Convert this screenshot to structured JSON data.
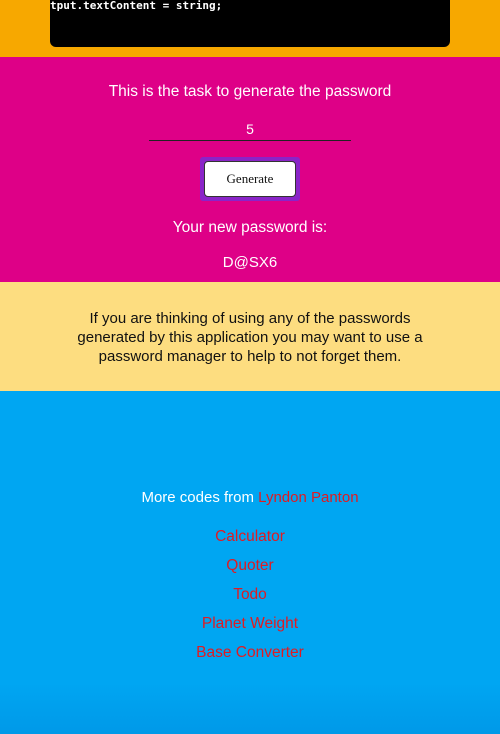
{
  "code": {
    "line": "tput.textContent = string;"
  },
  "task": {
    "title": "This is the task to generate the password",
    "length_value": "5",
    "generate_label": "Generate",
    "new_label": "Your new password is:",
    "password": "D@SX6"
  },
  "notice": {
    "text": "If you are thinking of using any of the passwords generated by this application you may want to use a password manager to help to not forget them."
  },
  "footer": {
    "more_prefix": "More codes from",
    "author": "Lyndon Panton",
    "links": [
      "Calculator",
      "Quoter",
      "Todo",
      "Planet Weight",
      "Base Converter"
    ]
  },
  "colors": {
    "orange": "#f7a800",
    "magenta": "#de0087",
    "yellow": "#fddd80",
    "blue": "#00a6f2",
    "link_red": "#e01b22",
    "purple": "#8a24c8"
  }
}
